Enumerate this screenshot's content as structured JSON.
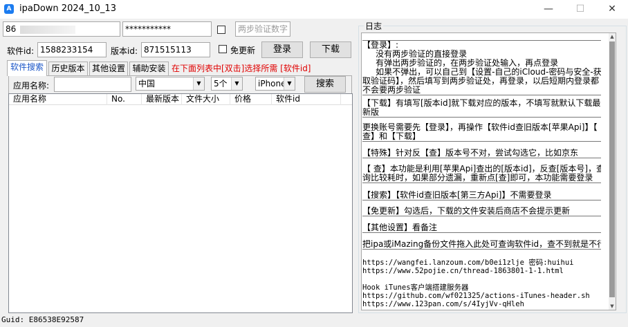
{
  "window": {
    "title": "ipaDown 2024_10_13",
    "icon": "app-store-icon",
    "min_glyph": "—",
    "max_glyph": "☐",
    "close_glyph": "✕"
  },
  "login": {
    "account_value": "86",
    "password_value": "***********",
    "two_step_placeholder": "两步验证数字",
    "two_step_checked": false
  },
  "app_row": {
    "software_id_label": "软件id:",
    "software_id_value": "1588233154",
    "version_id_label": "版本id:",
    "version_id_value": "871515113",
    "no_update_label": "免更新",
    "no_update_checked": false,
    "login_button": "登录",
    "download_button": "下载"
  },
  "tabs": [
    {
      "label": "软件搜索",
      "active": true
    },
    {
      "label": "历史版本",
      "active": false
    },
    {
      "label": "其他设置",
      "active": false
    },
    {
      "label": "辅助安装",
      "active": false
    }
  ],
  "hint": "在下面列表中[双击]选择所需 [软件id]",
  "search": {
    "app_name_label": "应用名称:",
    "app_name_value": "",
    "region_value": "中国",
    "count_value": "5个",
    "device_value": "iPhone",
    "search_button": "搜索"
  },
  "results": {
    "columns": [
      "应用名称",
      "No.",
      "最新版本",
      "文件大小",
      "价格",
      "软件id"
    ],
    "rows": []
  },
  "log": {
    "title": "日志",
    "blocks": [
      [
        "【登录】:",
        "     没有两步验证的直接登录",
        "     有弹出两步验证的，在两步验证处输入，再点登录",
        "     如果不弹出，可以自己到【设置-自己的iCloud-密码与安全-获",
        "取验证码】，然后填写到两步验证处，再登录，以后短期内登录都",
        "不会要两步验证"
      ],
      [
        "【下载】有填写[版本id]就下载对应的版本，不填写就默认下载最",
        "新版"
      ],
      [
        "更换账号需要先【登录】，再操作【软件id查旧版本[苹果Api]】【",
        "查】和【下载】"
      ],
      [
        "【特殊】针对反【查】版本号不对，尝试勾选它，比如京东"
      ],
      [
        "【 查】本功能是利用[苹果Api]查出的[版本id]，反查[版本号]，查",
        "询比较耗时，如果部分遗漏，重新点[查]即可，本功能需要登录"
      ],
      [
        "【搜索】【软件id查旧版本[第三方Api]】不需要登录"
      ],
      [
        "【免更新】勾选后，下载的文件安装后商店不会提示更新"
      ],
      [
        "【其他设置】看备注"
      ],
      [
        "把ipa或iMazing备份文件拖入此处可查询软件id，查不到就是不行"
      ]
    ],
    "links": [
      "https://wangfei.lanzoum.com/b0ei1zlje 密码:huihui",
      "https://www.52pojie.cn/thread-1863801-1-1.html",
      "",
      "Hook iTunes客户端搭建服务器",
      "https://github.com/wf021325/actions-iTunes-header.sh",
      "https://www.123pan.com/s/4IyjVv-qHleh"
    ]
  },
  "status": {
    "guid": "Guid: E86538E92587"
  }
}
